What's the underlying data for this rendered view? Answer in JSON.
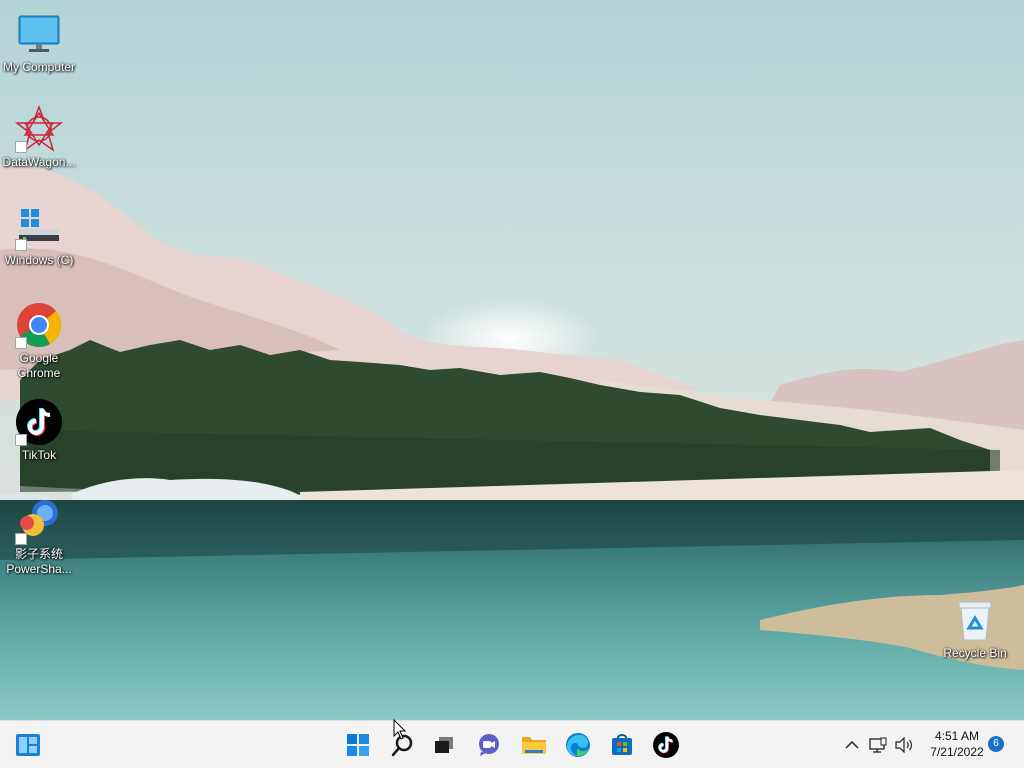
{
  "desktop": {
    "icons": [
      {
        "label": "My Computer"
      },
      {
        "label": "DataWagon..."
      },
      {
        "label": "Windows (C)"
      },
      {
        "label": "Google Chrome"
      },
      {
        "label": "TikTok"
      },
      {
        "label": "影子系统 PowerSha..."
      },
      {
        "label": "Recycle Bin"
      }
    ]
  },
  "taskbar": {
    "apps": [
      "Widgets",
      "Start",
      "Search",
      "Task View",
      "Chat",
      "File Explorer",
      "Microsoft Edge",
      "Microsoft Store",
      "TikTok"
    ],
    "tray": {
      "time": "4:51 AM",
      "date": "7/21/2022",
      "notification_count": "6"
    }
  },
  "colors": {
    "sky": "#bcd9dc",
    "lake": "#3f8e8c",
    "taskbar": "#f3f3f3",
    "accent": "#0067c0"
  }
}
